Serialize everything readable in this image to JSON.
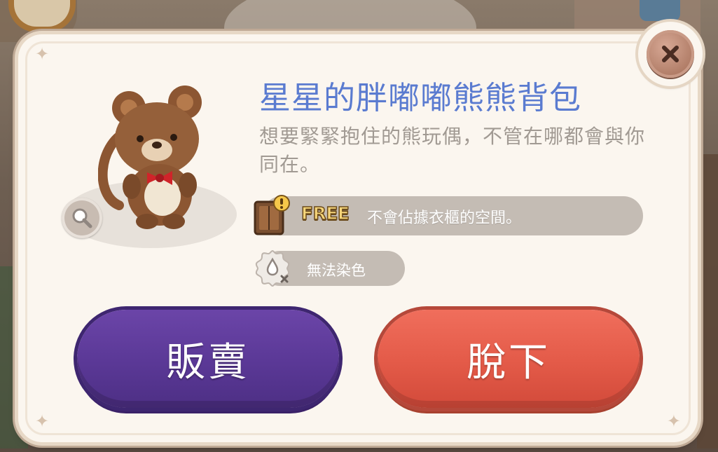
{
  "item": {
    "name": "星星的胖嘟嘟熊熊背包",
    "description": "想要緊緊抱住的熊玩偶，不管在哪都會與你同在。"
  },
  "attributes": {
    "free_badge": "FREE",
    "wardrobe_note": "不會佔據衣櫃的空間。",
    "dye_note": "無法染色"
  },
  "buttons": {
    "sell": "販賣",
    "unequip": "脫下"
  },
  "icons": {
    "close": "close-icon",
    "zoom": "magnifier-icon",
    "wardrobe": "wardrobe-icon",
    "dye": "no-dye-icon"
  },
  "colors": {
    "title": "#5a7bd0",
    "sell_button": "#5a3896",
    "unequip_button": "#e35a48"
  }
}
